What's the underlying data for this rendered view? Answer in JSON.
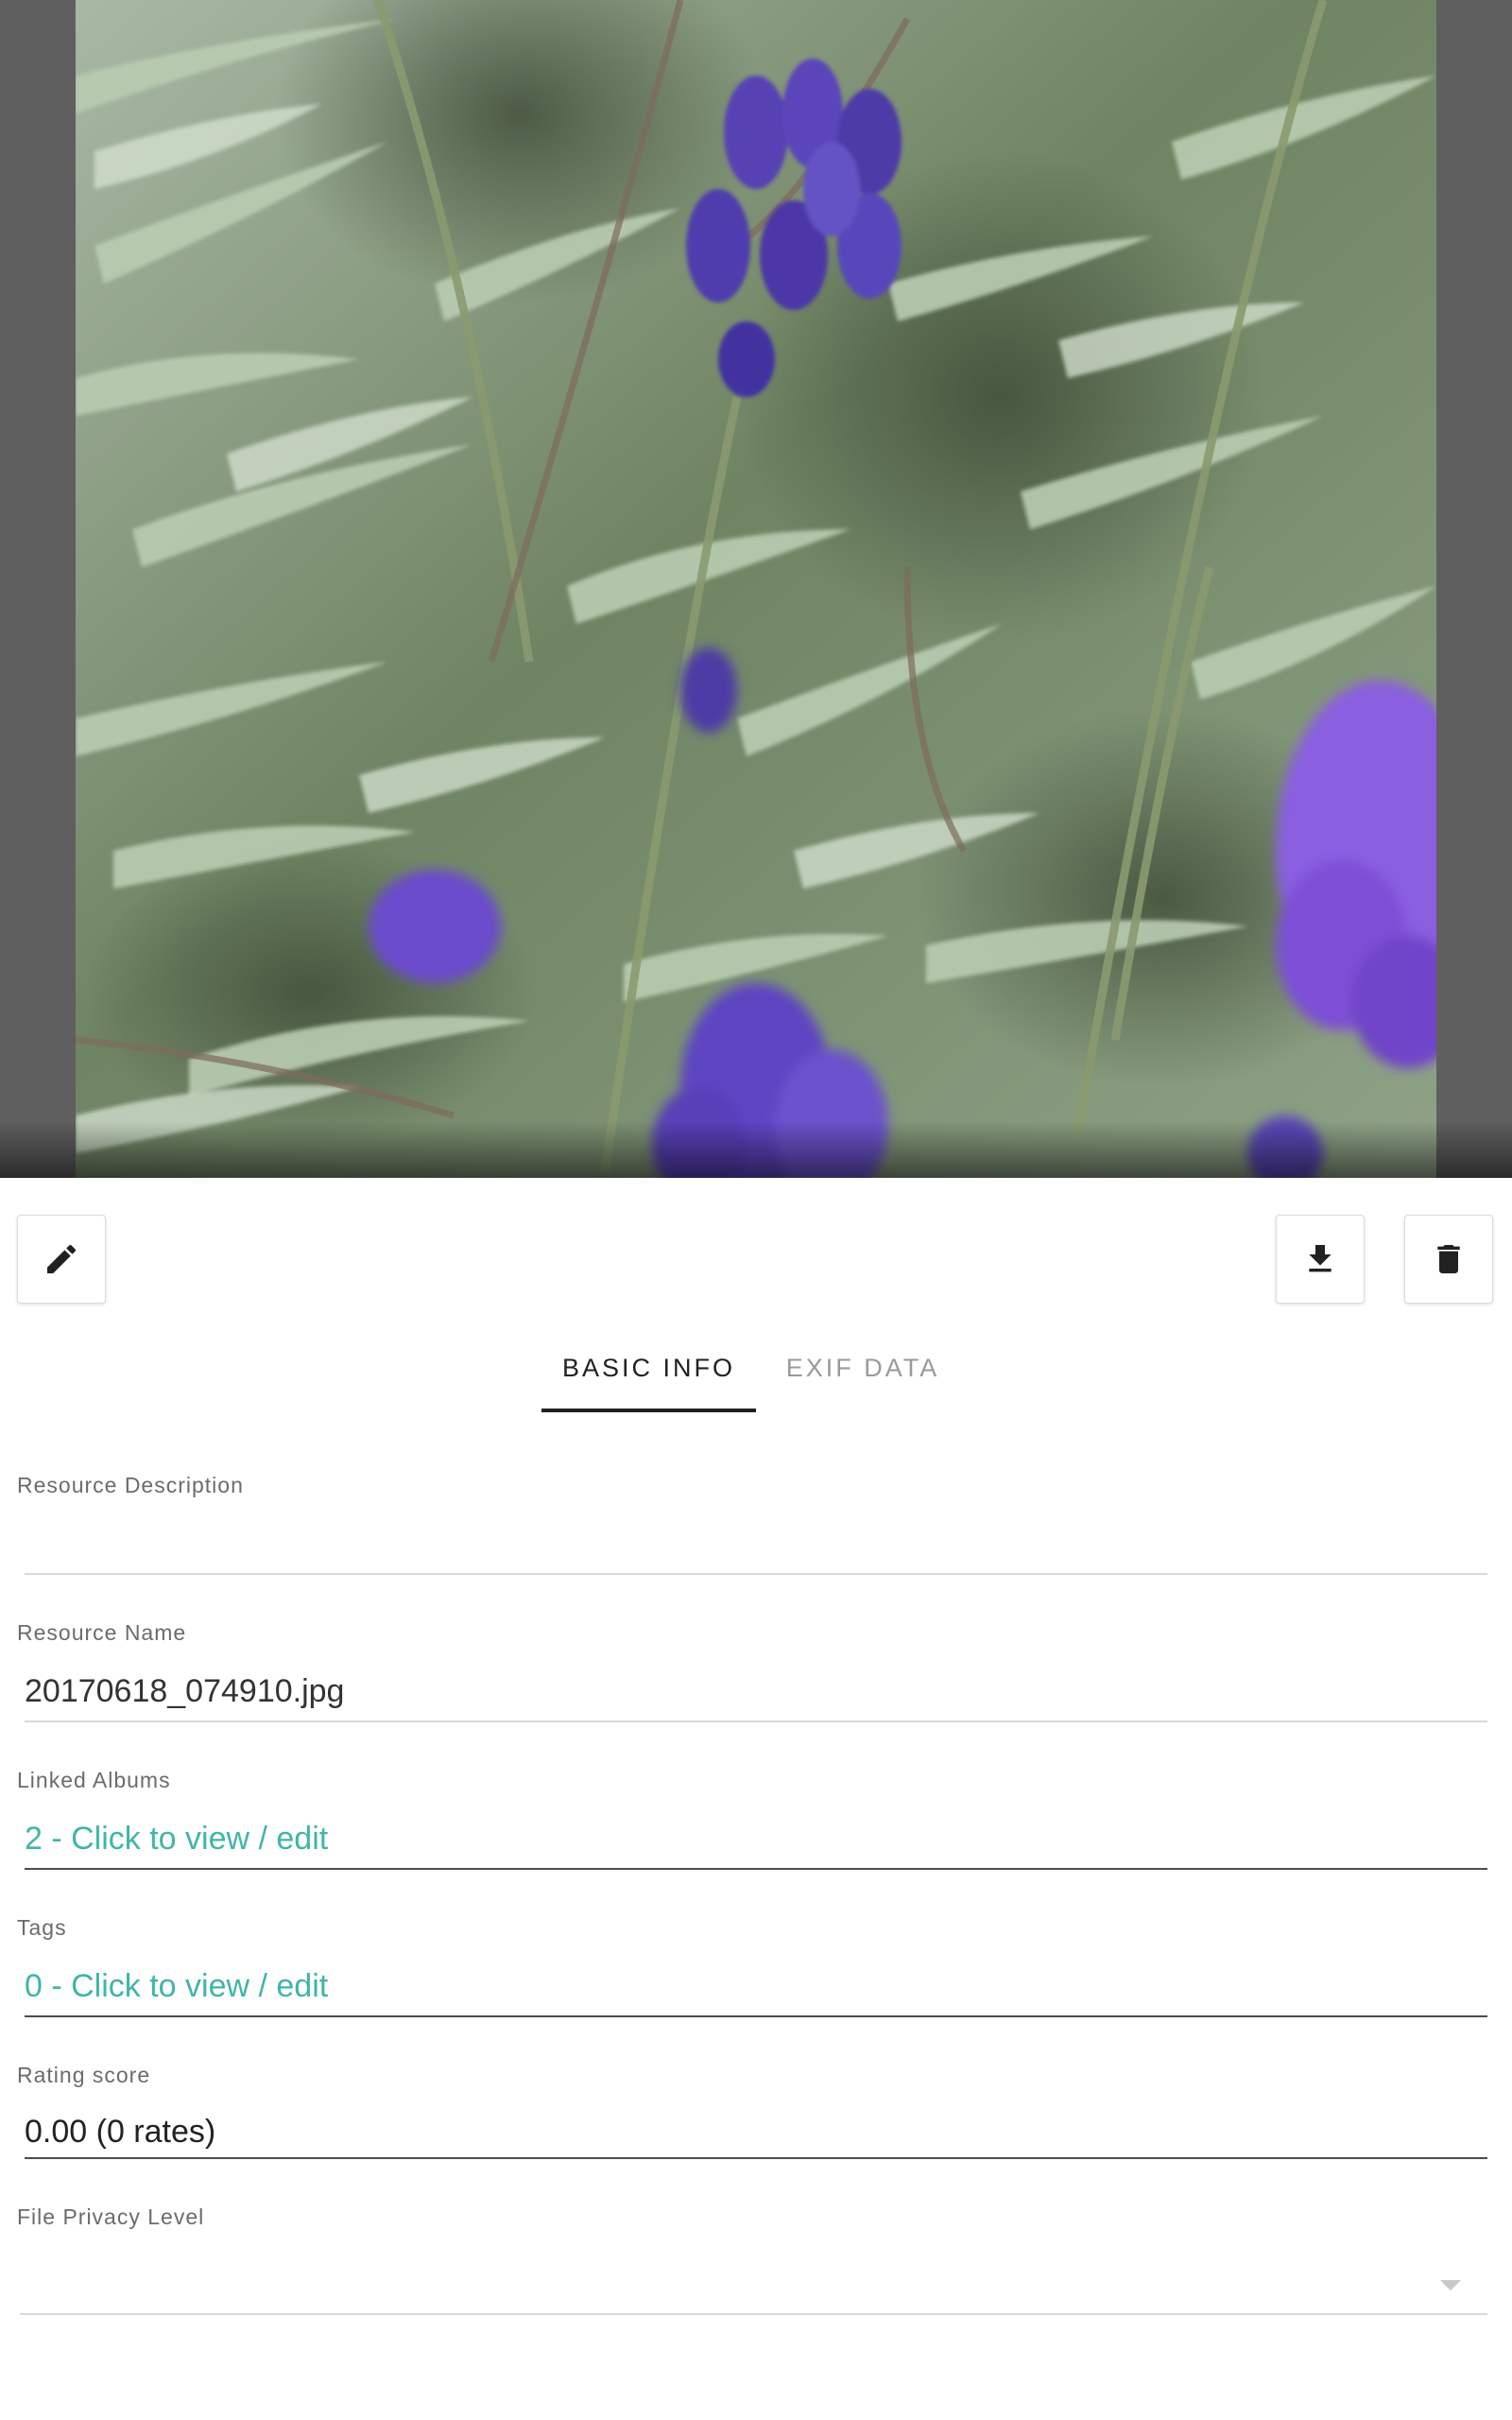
{
  "toolbar": {
    "edit_icon": "pencil-icon",
    "download_icon": "download-icon",
    "delete_icon": "trash-icon"
  },
  "tabs": [
    {
      "label": "BASIC INFO",
      "active": true
    },
    {
      "label": "EXIF DATA",
      "active": false
    }
  ],
  "fields": {
    "description": {
      "label": "Resource Description",
      "value": ""
    },
    "name": {
      "label": "Resource Name",
      "value": "20170618_074910.jpg"
    },
    "albums": {
      "label": "Linked Albums",
      "value": "2 - Click to view / edit"
    },
    "tags": {
      "label": "Tags",
      "value": "0 - Click to view / edit"
    },
    "rating": {
      "label": "Rating score",
      "value": "0.00 (0 rates)"
    },
    "privacy": {
      "label": "File Privacy Level",
      "value": ""
    }
  },
  "colors": {
    "link": "#3fb6a8",
    "tab_active": "#212121",
    "tab_inactive": "#9a9a9a",
    "viewer_background": "#5f5f5f"
  }
}
